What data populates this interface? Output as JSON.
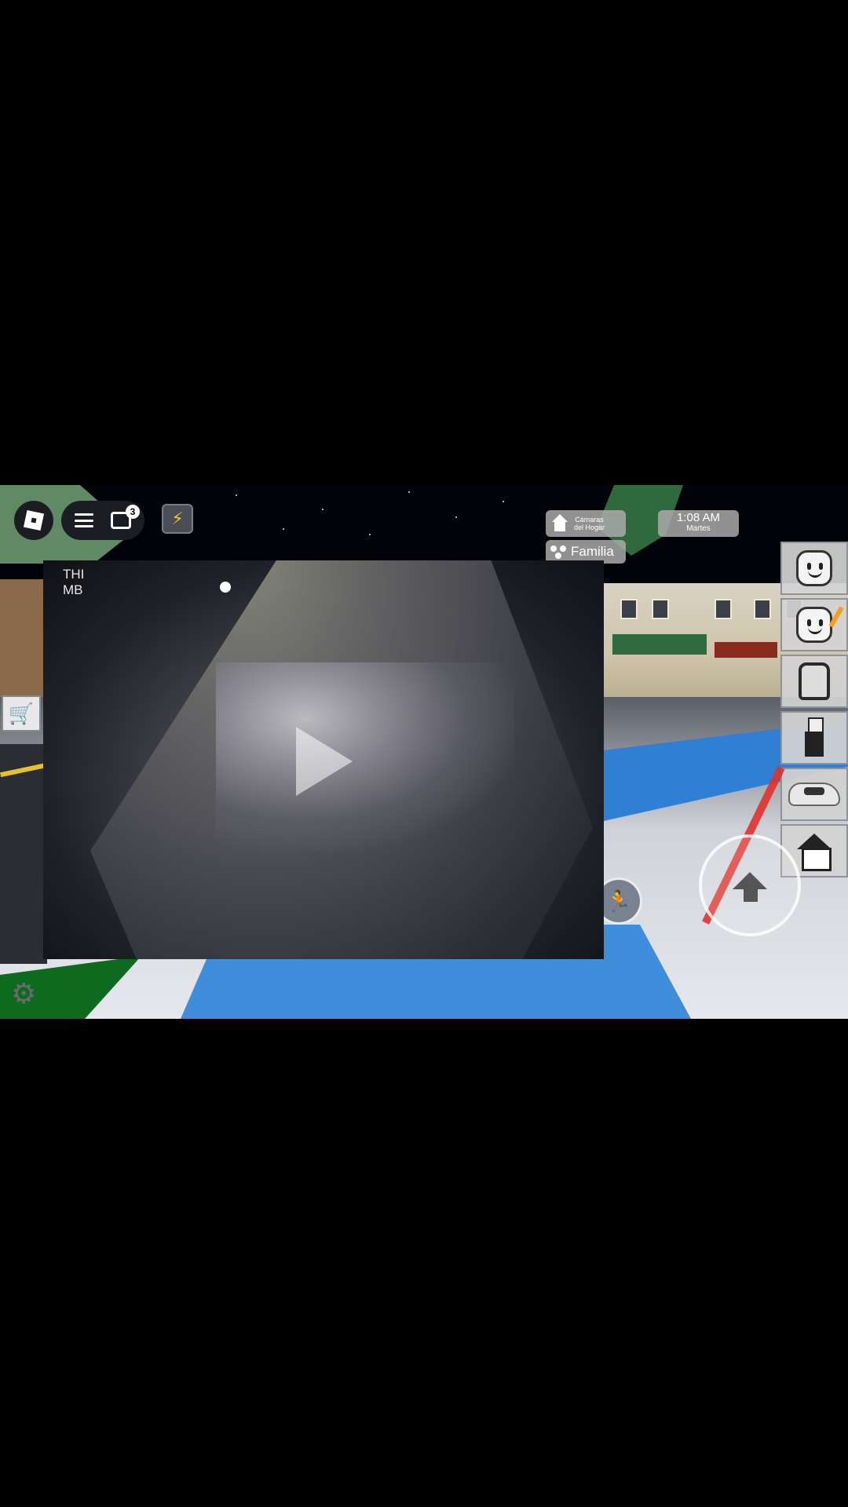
{
  "topbar": {
    "roblox_icon": "roblox-logo-icon",
    "menu_icon": "hamburger-icon",
    "chat_icon": "chat-icon",
    "chat_badge": "3",
    "emote_icon": "lightning-icon",
    "emote_glyph": "⚡"
  },
  "hud": {
    "cameras_line1": "Cámaras",
    "cameras_line2": "del Hogar",
    "time": "1:08 AM",
    "day": "Martes",
    "family_label": "Familia"
  },
  "video": {
    "corner_text_1": "THI",
    "corner_text_2": "MB"
  },
  "toolbar": {
    "items": [
      "avatar-face-icon",
      "avatar-edit-icon",
      "backpack-icon",
      "character-icon",
      "car-icon",
      "house-icon"
    ]
  },
  "controls": {
    "run_glyph": "🏃",
    "shop_glyph": "🛒",
    "settings_glyph": "⚙"
  },
  "colors": {
    "accent_bolt": "#f3c22c",
    "hud_panel": "#aaaaaa",
    "red_slash": "#e0322c"
  }
}
